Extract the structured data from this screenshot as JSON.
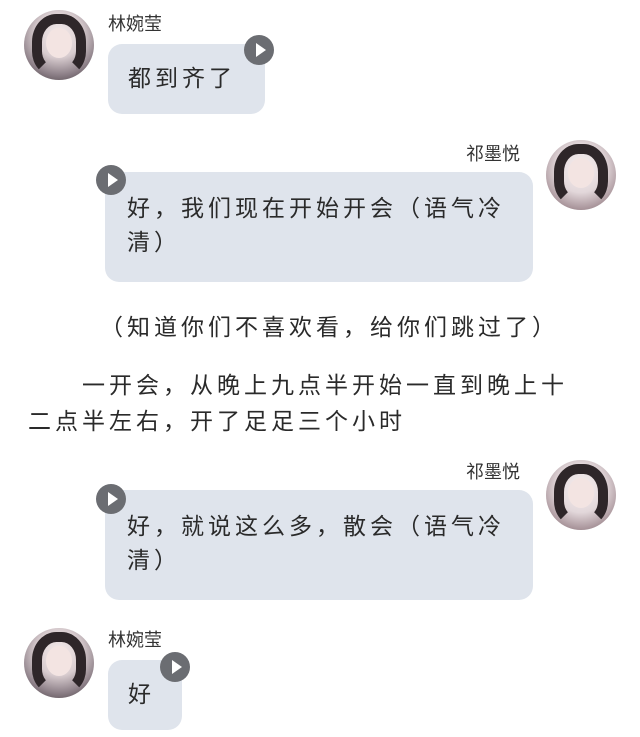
{
  "messages": [
    {
      "sender": "林婉莹",
      "side": "left",
      "text": "都到齐了"
    },
    {
      "sender": "祁墨悦",
      "side": "right",
      "text": "好，我们现在开始开会（语气冷清）"
    },
    {
      "sender": "祁墨悦",
      "side": "right",
      "text": "好，就说这么多，散会（语气冷清）"
    },
    {
      "sender": "林婉莹",
      "side": "left",
      "text": "好"
    }
  ],
  "narration": {
    "line1": "（知道你们不喜欢看，给你们跳过了）",
    "line2": "　　一开会，从晚上九点半开始一直到晚上十",
    "line3": "二点半左右，开了足足三个小时"
  }
}
